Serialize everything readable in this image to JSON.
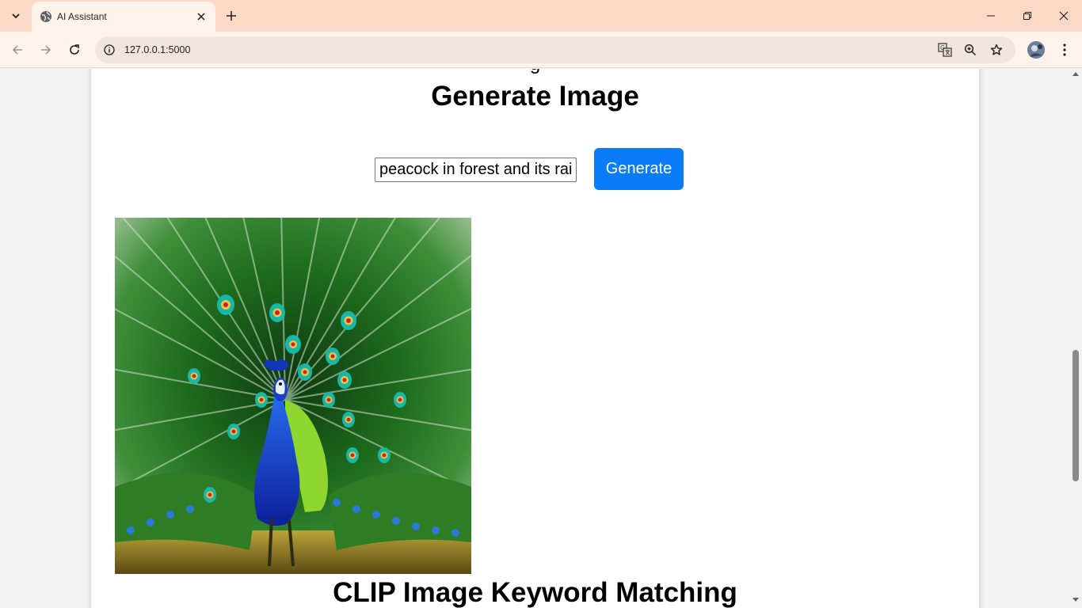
{
  "browser": {
    "tab_title": "AI Assistant",
    "url": "127.0.0.1:5000",
    "icons": {
      "tab_search": "chevron-down-icon",
      "favicon": "globe-icon",
      "tab_close": "close-icon",
      "new_tab": "plus-icon",
      "back": "arrow-left-icon",
      "forward": "arrow-right-icon",
      "reload": "reload-icon",
      "site_info": "info-icon",
      "translate": "translate-icon",
      "zoom": "zoom-icon",
      "bookmark": "star-icon",
      "profile": "avatar",
      "menu": "kebab-menu-icon",
      "minimize": "minimize-icon",
      "restore": "restore-icon",
      "close_window": "close-icon"
    },
    "colors": {
      "tabstrip": "#fcd9c6",
      "toolbar": "#fff3ec",
      "omnibox": "#f1e5de"
    }
  },
  "page": {
    "prev_heading_fragment": "g",
    "generate_section": {
      "title": "Generate Image",
      "prompt_value": "peacock in forest and its rai",
      "button_label": "Generate",
      "image_alt": "peacock with fanned tail feathers"
    },
    "next_section_title": "CLIP Image Keyword Matching",
    "colors": {
      "button": "#0a7cf7",
      "background": "#f3f3f3",
      "card": "#ffffff"
    }
  }
}
